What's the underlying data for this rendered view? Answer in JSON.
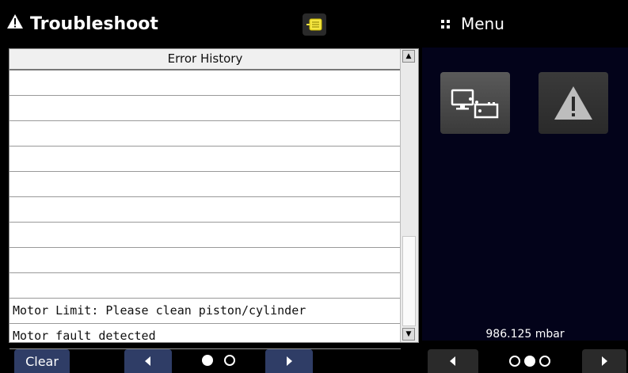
{
  "header": {
    "title": "Troubleshoot",
    "title_icon": "warning-icon",
    "notes_icon": "note-icon"
  },
  "error_history": {
    "heading": "Error History",
    "rows": [
      "",
      "",
      "",
      "",
      "",
      "",
      "",
      "",
      "",
      "Motor Limit: Please clean piston/cylinder",
      "Motor fault detected"
    ]
  },
  "footer_left": {
    "clear_label": "Clear",
    "pages": 2,
    "current_page": 1
  },
  "menu": {
    "title": "Menu",
    "tiles": [
      "display-settings-icon",
      "troubleshoot-warning-icon"
    ],
    "pressure_reading": "986.125 mbar",
    "pages": 3,
    "current_page": 2
  },
  "colors": {
    "button_bg": "#2f3d66",
    "menu_bg": "#03031a",
    "note_icon": "#f5e642"
  }
}
